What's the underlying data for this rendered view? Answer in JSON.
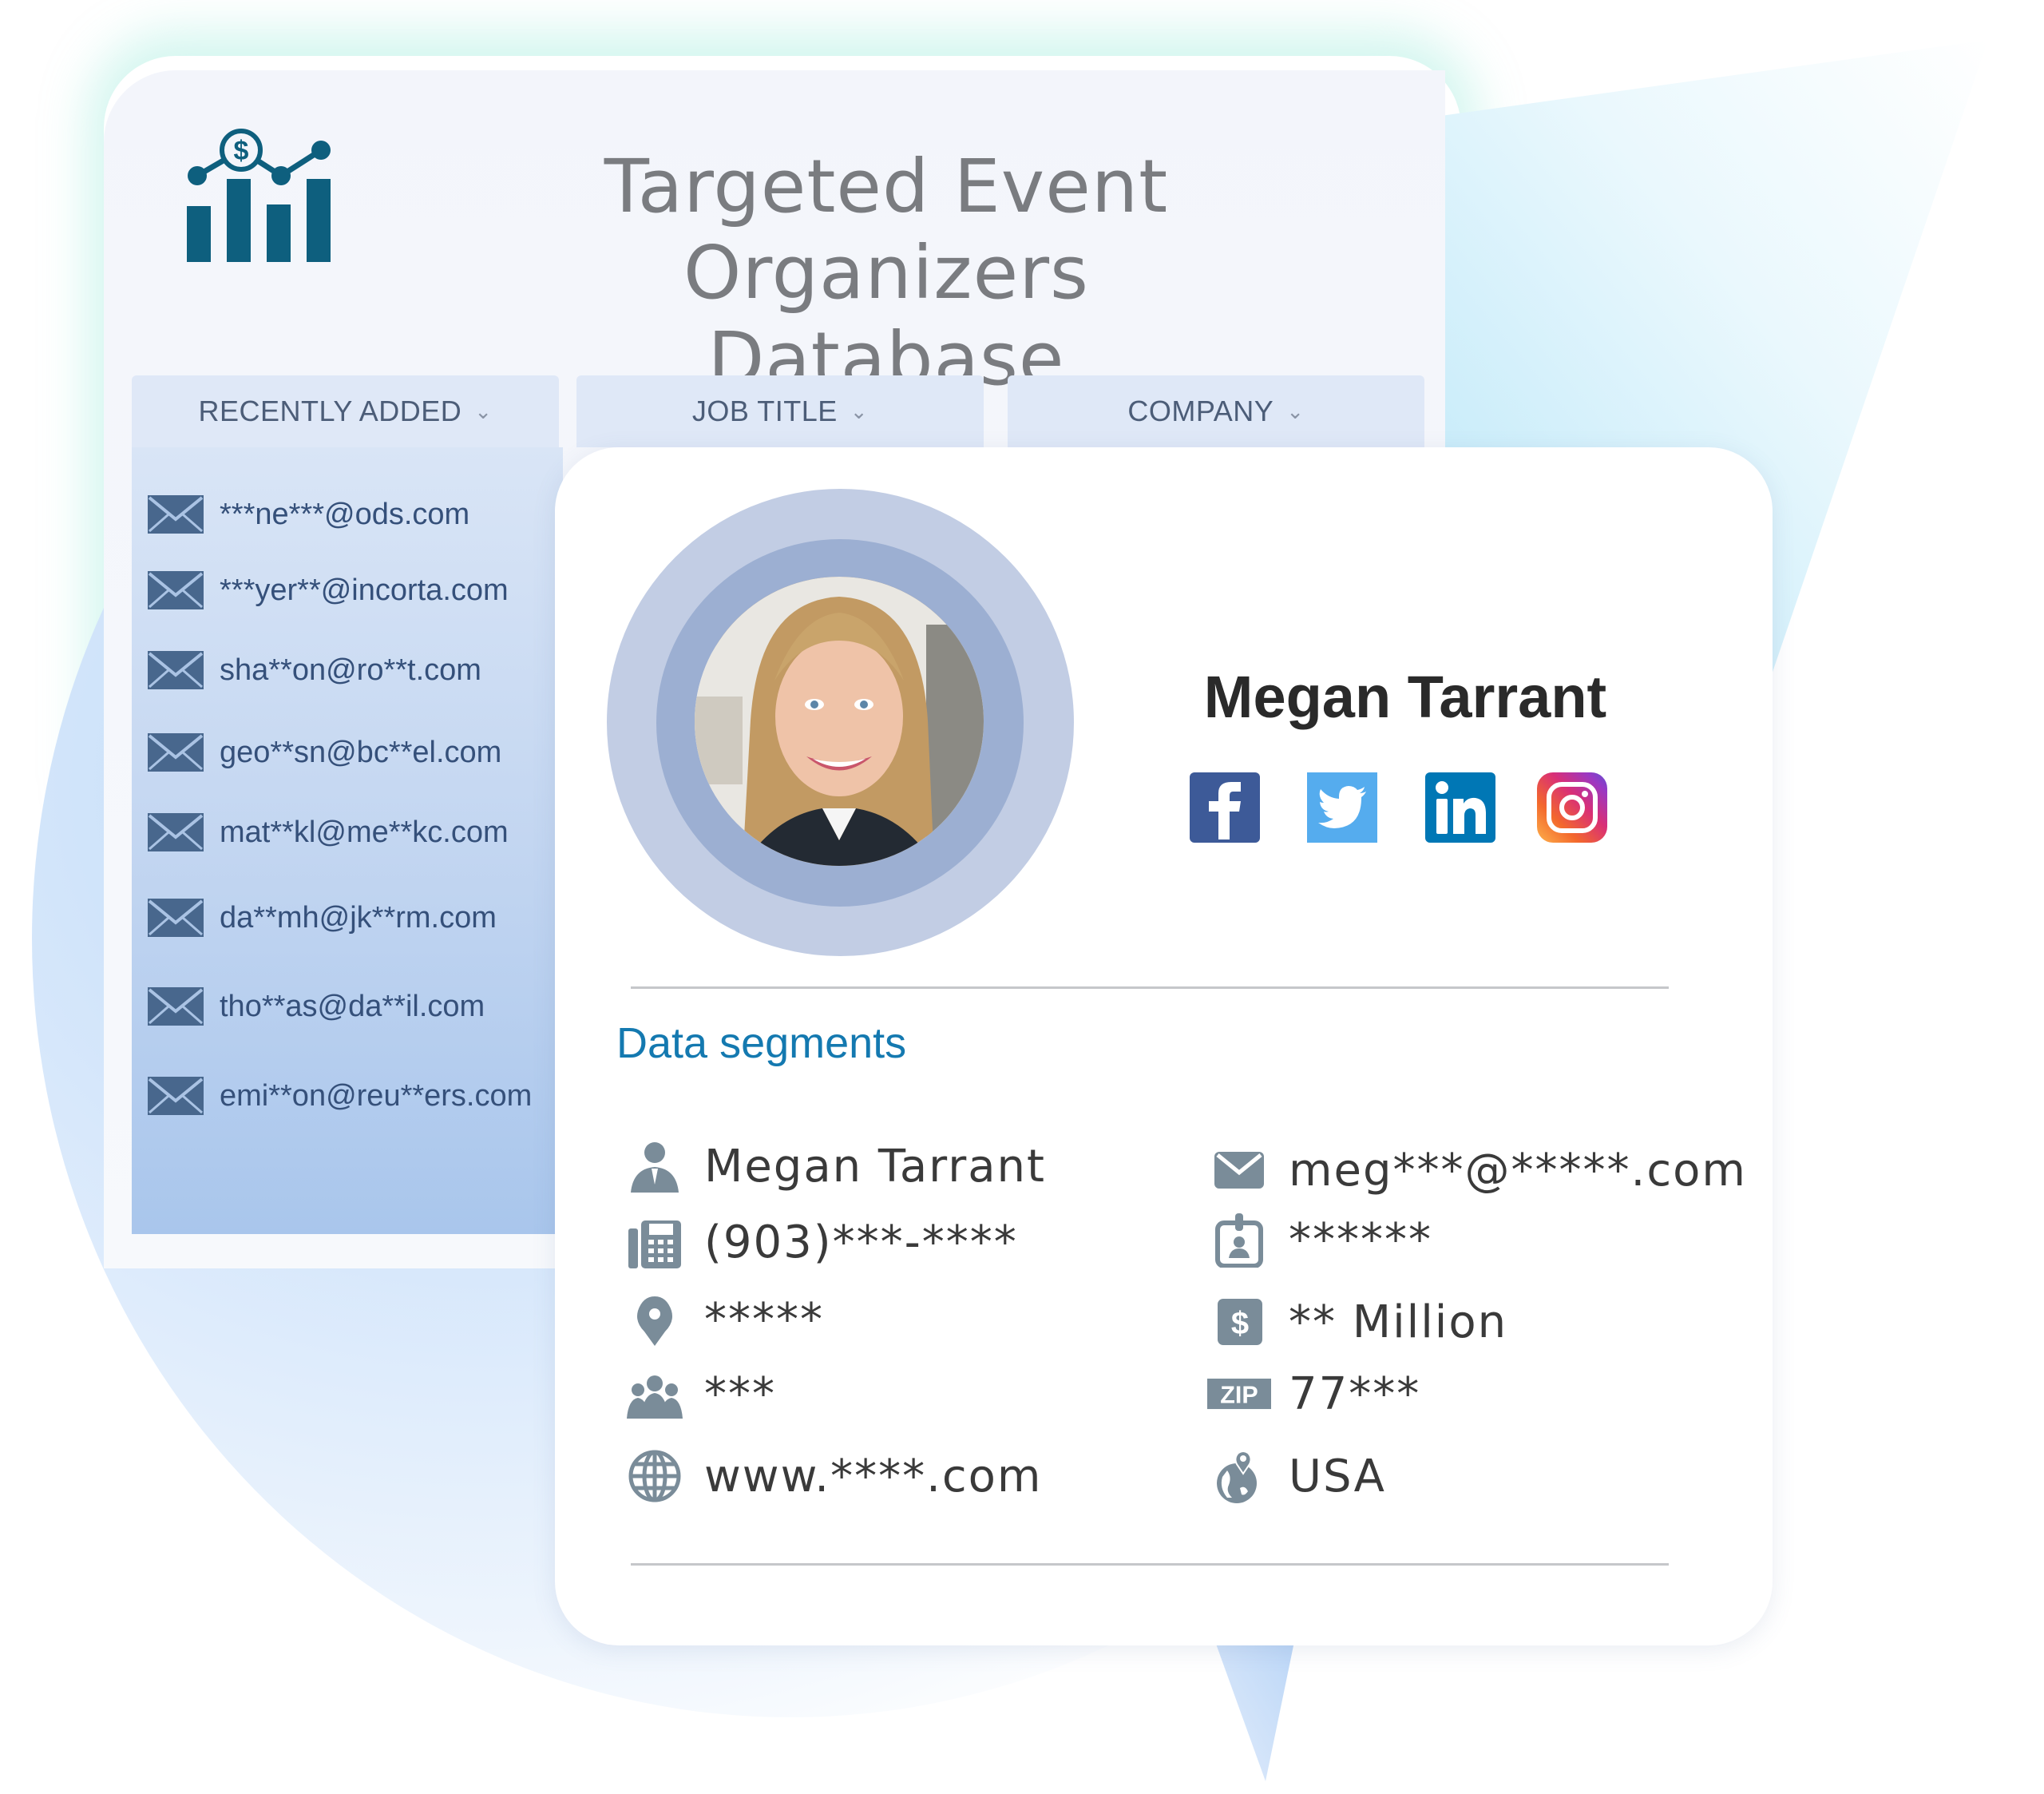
{
  "title": {
    "line1": "Targeted Event Organizers",
    "line2": "Database"
  },
  "columns": [
    {
      "label": "RECENTLY ADDED",
      "chevron": "⌄"
    },
    {
      "label": "JOB TITLE",
      "chevron": "⌄"
    },
    {
      "label": "COMPANY",
      "chevron": "⌄"
    }
  ],
  "recent_emails": [
    "***ne***@ods.com",
    "***yer**@incorta.com",
    "sha**on@ro**t.com",
    "geo**sn@bc**el.com",
    "mat**kl@me**kc.com",
    "da**mh@jk**rm.com",
    "tho**as@da**il.com",
    "emi**on@reu**ers.com"
  ],
  "profile": {
    "name": "Megan Tarrant",
    "socials": [
      {
        "name": "facebook",
        "glyph": "f",
        "color": "#3d5a98"
      },
      {
        "name": "twitter",
        "glyph": "bird",
        "color": "#55acee"
      },
      {
        "name": "linkedin",
        "glyph": "in",
        "color": "#0077b5"
      },
      {
        "name": "instagram",
        "glyph": "camera",
        "color": "#d92f76"
      }
    ]
  },
  "segments": {
    "title": "Data segments",
    "left": [
      {
        "icon": "person-icon",
        "value": "Megan Tarrant"
      },
      {
        "icon": "phone-fax-icon",
        "value": "(903)***-****"
      },
      {
        "icon": "location-pin-icon",
        "value": "*****"
      },
      {
        "icon": "team-icon",
        "value": "***"
      },
      {
        "icon": "globe-icon",
        "value": "www.****.com"
      }
    ],
    "right": [
      {
        "icon": "envelope-icon",
        "value": "meg***@*****.com"
      },
      {
        "icon": "id-badge-icon",
        "value": "******"
      },
      {
        "icon": "dollar-icon",
        "value": "** Million"
      },
      {
        "icon": "zip-icon",
        "value": "77***"
      },
      {
        "icon": "globe-pin-icon",
        "value": "USA"
      }
    ]
  },
  "colors": {
    "accent": "#1479b0",
    "icon_gray": "#7a8c99",
    "logo": "#0e5f7e",
    "email_text": "#35507a"
  }
}
